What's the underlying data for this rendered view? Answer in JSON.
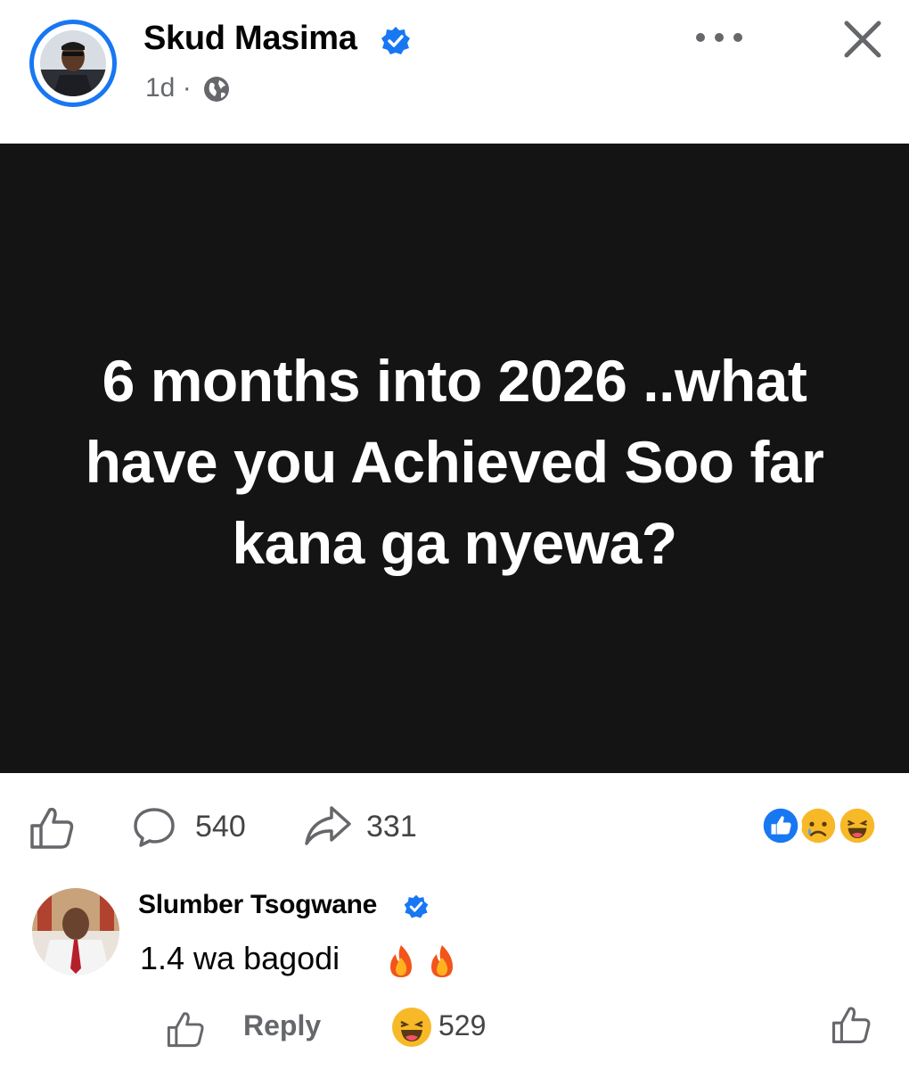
{
  "post": {
    "author": "Skud Masima",
    "time": "1d",
    "separator": "·",
    "text": "6 months into 2026 ..what have you Achieved Soo far kana ga nyewa?",
    "background_color": "#141414",
    "text_color": "#ffffff"
  },
  "actions": {
    "like_icon": "like-icon",
    "comment_icon": "comment-icon",
    "comment_count": "540",
    "share_icon": "share-icon",
    "share_count": "331",
    "reactions": [
      "like",
      "sad",
      "haha"
    ]
  },
  "comment": {
    "author": "Slumber Tsogwane",
    "text": "1.4 wa bagodi",
    "emojis": [
      "fire",
      "fire"
    ],
    "reply_label": "Reply",
    "reaction": "haha",
    "reaction_count": "529"
  },
  "colors": {
    "accent": "#1877f2",
    "secondary_text": "#65676b",
    "reaction_yellow": "#f7b928"
  }
}
